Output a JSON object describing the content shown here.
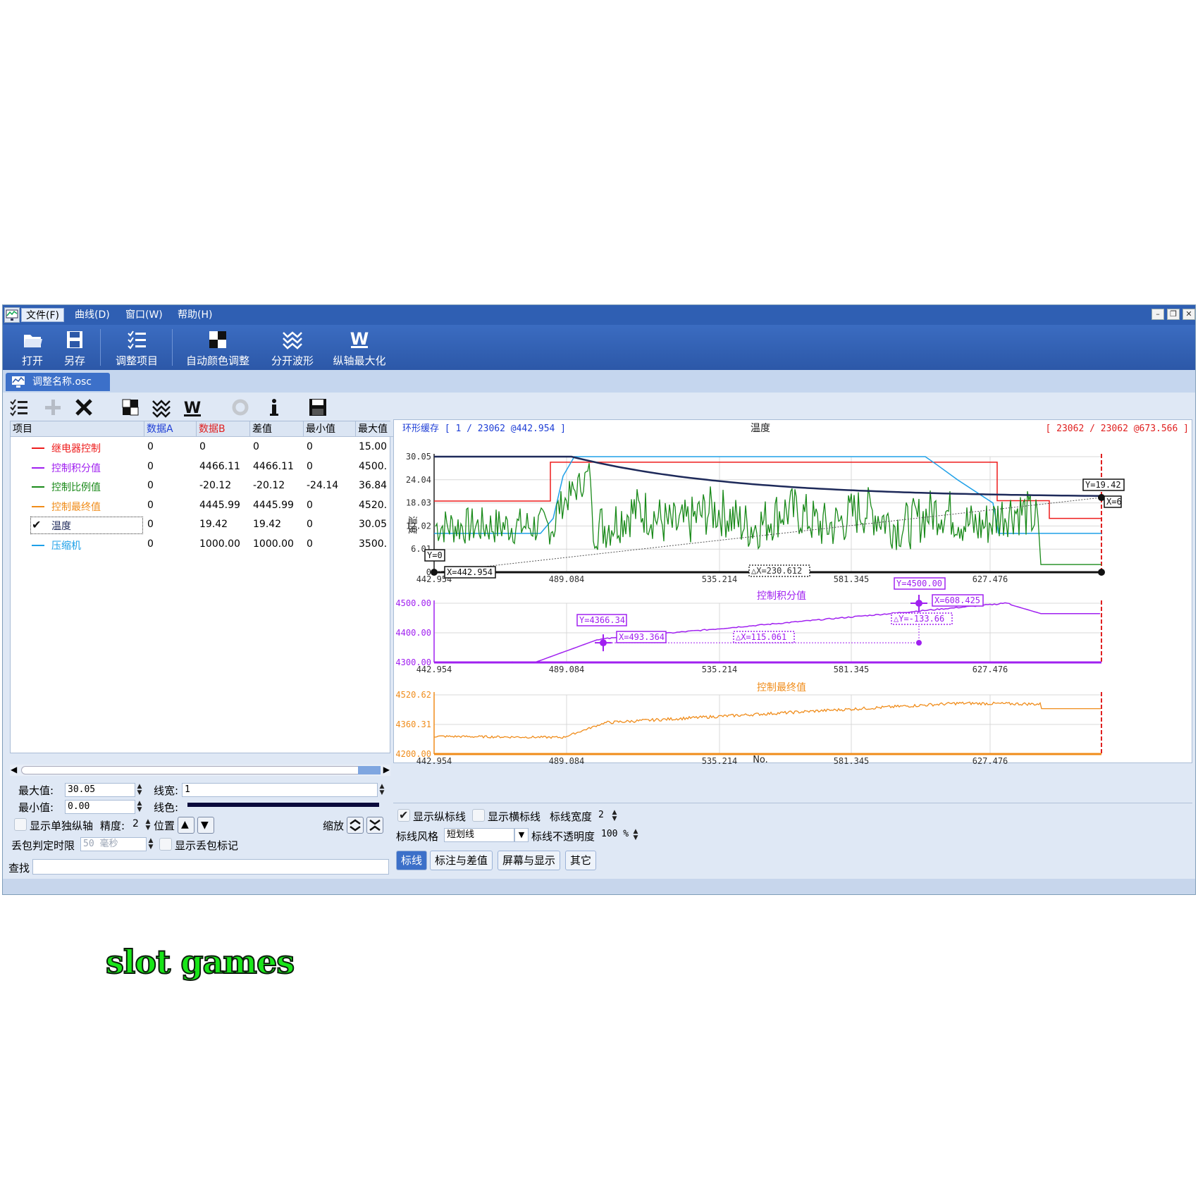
{
  "menu": [
    "文件(F)",
    "曲线(D)",
    "窗口(W)",
    "帮助(H)"
  ],
  "toolbar": {
    "open": "打开",
    "save_as": "另存",
    "adjust_items": "调整项目",
    "auto_color": "自动颜色调整",
    "split_waves": "分开波形",
    "max_y_axis": "纵轴最大化"
  },
  "document_tab": "调整名称.osc",
  "grid": {
    "headers": [
      "项目",
      "数据A",
      "数据B",
      "差值",
      "最小值",
      "最大值"
    ],
    "header_colors": [
      "#000000",
      "#1f3fd6",
      "#e02020",
      "#000000",
      "#000000",
      "#000000"
    ],
    "rows": [
      {
        "name": "继电器控制",
        "color": "#ee1c1c",
        "a": "0",
        "b": "0",
        "diff": "0",
        "min": "0",
        "max": "15.00",
        "checked": false
      },
      {
        "name": "控制积分值",
        "color": "#a020f0",
        "a": "0",
        "b": "4466.11",
        "diff": "4466.11",
        "min": "0",
        "max": "4500.",
        "checked": false
      },
      {
        "name": "控制比例值",
        "color": "#1a8a1a",
        "a": "0",
        "b": "-20.12",
        "diff": "-20.12",
        "min": "-24.14",
        "max": "36.84",
        "checked": false
      },
      {
        "name": "控制最终值",
        "color": "#f08c1a",
        "a": "0",
        "b": "4445.99",
        "diff": "4445.99",
        "min": "0",
        "max": "4520.",
        "checked": false
      },
      {
        "name": "温度",
        "color": "#1e2a5a",
        "a": "0",
        "b": "19.42",
        "diff": "19.42",
        "min": "0",
        "max": "30.05",
        "checked": true
      },
      {
        "name": "压缩机",
        "color": "#1ea0e8",
        "a": "0",
        "b": "1000.00",
        "diff": "1000.00",
        "min": "0",
        "max": "3500.",
        "checked": false
      }
    ]
  },
  "props": {
    "max_label": "最大值:",
    "max_value": "30.05",
    "min_label": "最小值:",
    "min_value": "0.00",
    "line_width_label": "线宽:",
    "line_width_value": "1",
    "line_color_label": "线色:",
    "line_color": "#0a0a3c",
    "show_single_axis": "显示单独纵轴",
    "precision_label": "精度:",
    "precision_value": "2",
    "position_label": "位置",
    "zoom_label": "缩放",
    "loss_label": "丢包判定时限",
    "loss_value": "50 毫秒",
    "show_loss_mark": "显示丢包标记",
    "find_label": "查找"
  },
  "plot": {
    "header_left": "环形缓存 [ 1 / 23062 @442.954 ]",
    "header_right": "[ 23062 / 23062 @673.566 ]",
    "x_axis_label": "No.",
    "x_ticks": [
      "442.954",
      "489.084",
      "535.214",
      "581.345",
      "627.476"
    ],
    "panel1": {
      "title": "温度",
      "y_label": "温度",
      "y_ticks": [
        "30.05",
        "24.04",
        "18.03",
        "12.02",
        "6.01",
        "0"
      ],
      "marker_y0": "Y=0",
      "marker_x0": "X=442.954",
      "delta_x": "△X=230.612",
      "marker_y_right": "Y=19.42",
      "marker_x_right": "X=6"
    },
    "panel2": {
      "title": "控制积分值",
      "y_ticks": [
        "4500.00",
        "4400.00",
        "4300.00"
      ],
      "m1_y": "Y=4366.34",
      "m1_x": "X=493.364",
      "m2_y": "Y=4500.00",
      "m2_x": "X=608.425",
      "delta_x": "△X=115.061",
      "delta_y": "△Y=-133.66"
    },
    "panel3": {
      "title": "控制最终值",
      "y_ticks": [
        "4520.62",
        "4360.31",
        "4200.00"
      ]
    }
  },
  "marker_settings": {
    "show_vertical": "显示纵标线",
    "show_horizontal": "显示横标线",
    "width_label": "标线宽度",
    "width_value": "2",
    "style_label": "标线风格",
    "style_value": "短划线",
    "opacity_label": "标线不透明度",
    "opacity_value": "100 %"
  },
  "bottom_tabs": [
    "标线",
    "标注与差值",
    "屏幕与显示",
    "其它"
  ],
  "caption": "slot games",
  "colors": {
    "relay": "#ee1c1c",
    "integral": "#a020f0",
    "proportional": "#1a8a1a",
    "final": "#f08c1a",
    "temperature": "#1e2a5a",
    "compressor": "#1ea0e8"
  }
}
